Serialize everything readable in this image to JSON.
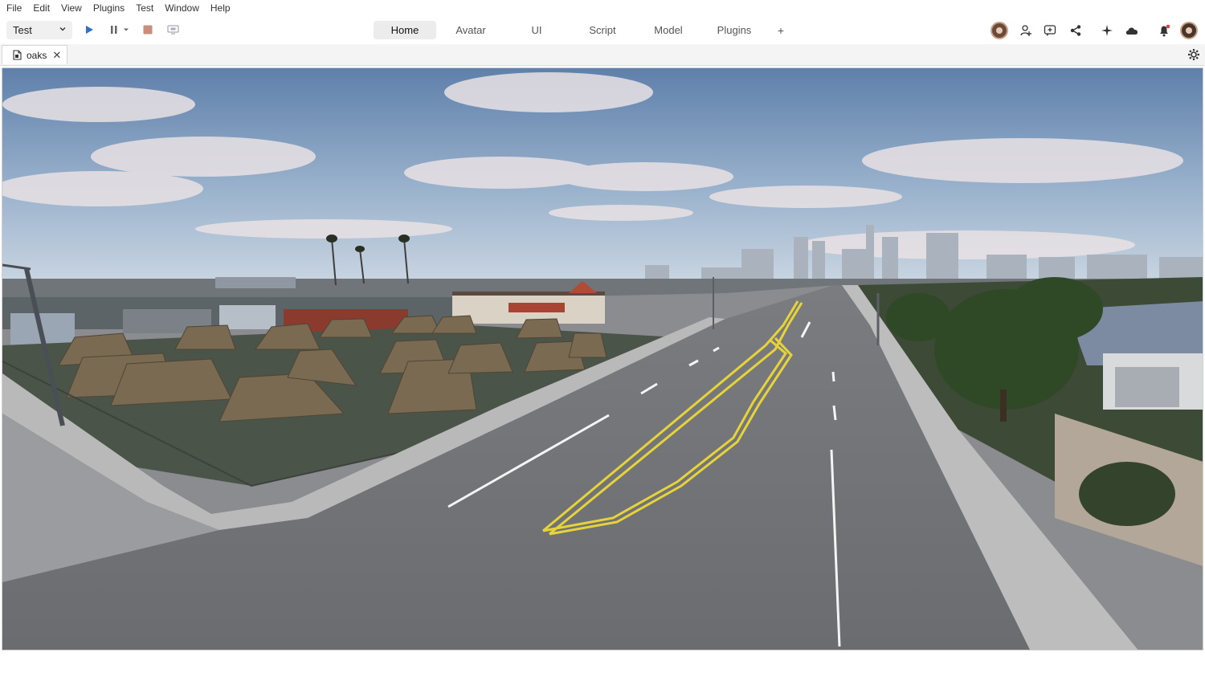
{
  "menu": [
    "File",
    "Edit",
    "View",
    "Plugins",
    "Test",
    "Window",
    "Help"
  ],
  "toolbar": {
    "mode_value": "Test",
    "icons": [
      "play-icon",
      "pause-icon",
      "stop-icon",
      "screen-icon"
    ]
  },
  "tabs": [
    "Home",
    "Avatar",
    "UI",
    "Script",
    "Model",
    "Plugins",
    "+"
  ],
  "active_tab": "Home",
  "right_icons": [
    "avatar",
    "add-friend-icon",
    "chat-icon",
    "share-icon",
    "sparkle-icon",
    "cloud-icon",
    "bell-icon",
    "profile-avatar"
  ],
  "document": {
    "tab_name": "oaks",
    "close": "✕"
  },
  "colors": {
    "sky_top": "#6f8fb6",
    "sky_bottom": "#c9d6e3",
    "road": "#6d6f72",
    "grass": "#4a5346",
    "sidewalk": "#b8b8b8",
    "center_line": "#e6d33a",
    "tent": "#7a6a52",
    "tree": "#2d4a22"
  }
}
